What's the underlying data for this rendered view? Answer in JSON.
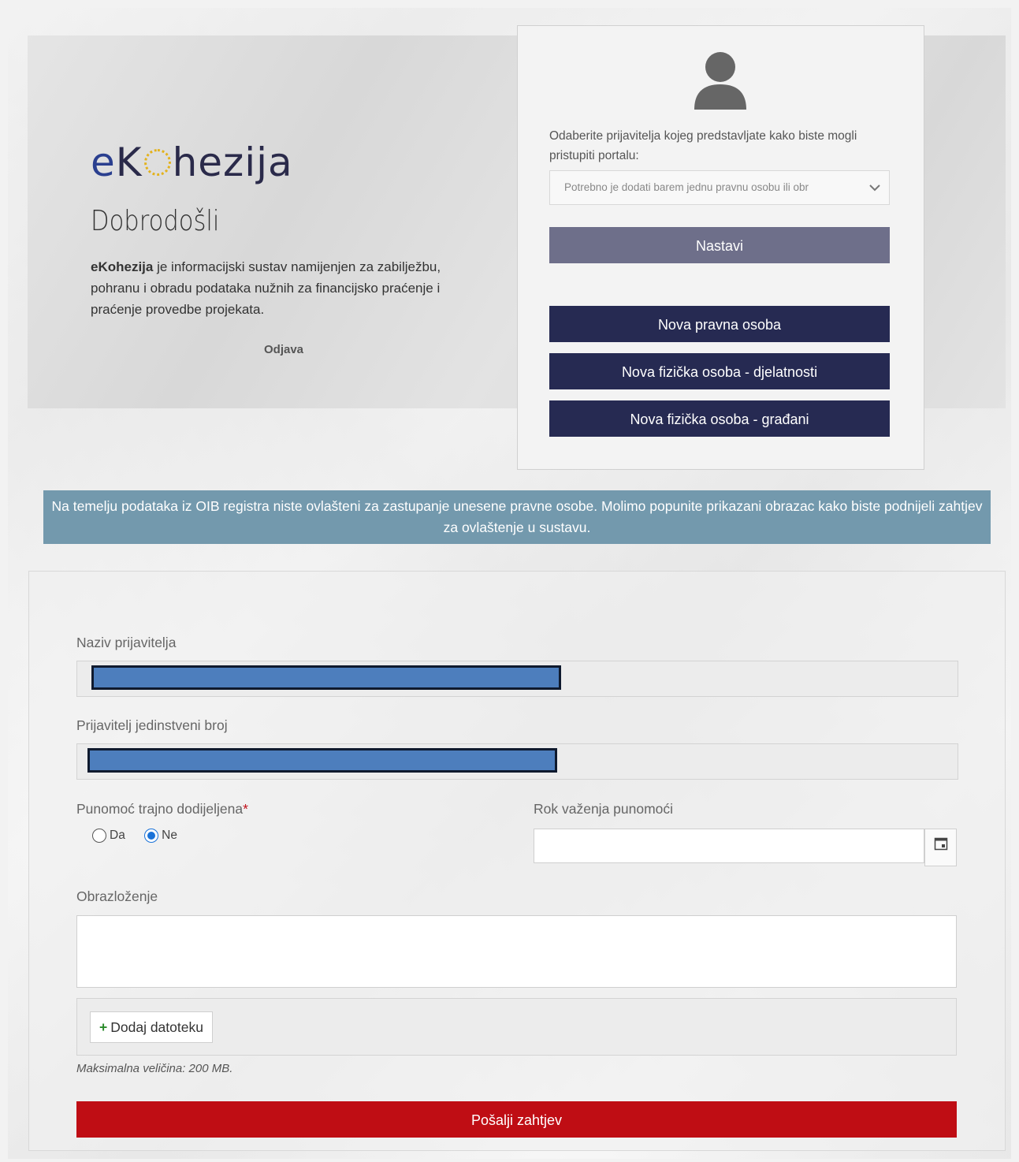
{
  "welcome": {
    "logo_text": "eKohezija",
    "title": "Dobrodošli",
    "desc_brand": "eKohezija",
    "desc_rest": " je informacijski sustav namijenjen za zabilježbu, pohranu i obradu podataka nužnih za financijsko praćenje i praćenje provedbe projekata.",
    "logout": "Odjava"
  },
  "login": {
    "avatar_icon": "user-icon",
    "prompt": "Odaberite prijavitelja kojeg predstavljate kako biste mogli pristupiti portalu:",
    "select_value": "Potrebno je dodati barem jednu pravnu osobu ili obr",
    "continue": "Nastavi",
    "btn_legal": "Nova pravna osoba",
    "btn_phys_business": "Nova fizička osoba - djelatnosti",
    "btn_phys_citizens": "Nova fizička osoba - građani"
  },
  "info_banner": "Na temelju podataka iz OIB registra niste ovlašteni za zastupanje unesene pravne osobe. Molimo popunite prikazani obrazac kako biste podnijeli zahtjev za ovlaštenje u sustavu.",
  "form": {
    "applicant_name_label": "Naziv prijavitelja",
    "applicant_id_label": "Prijavitelj jedinstveni broj",
    "permanent_label": "Punomoć trajno dodijeljena",
    "required_mark": "*",
    "radio_yes": "Da",
    "radio_no": "Ne",
    "selected": "Ne",
    "validity_label": "Rok važenja punomoći",
    "calendar_icon": "calendar-icon",
    "explanation_label": "Obrazloženje",
    "add_file": "Dodaj datoteku",
    "max_size": "Maksimalna veličina: 200 MB.",
    "submit": "Pošalji zahtjev"
  },
  "colors": {
    "dark_button": "#262a52",
    "continue_button": "#6e6f8a",
    "banner": "#7399ad",
    "submit": "#bf0d14",
    "radio_accent": "#1a72d8"
  }
}
